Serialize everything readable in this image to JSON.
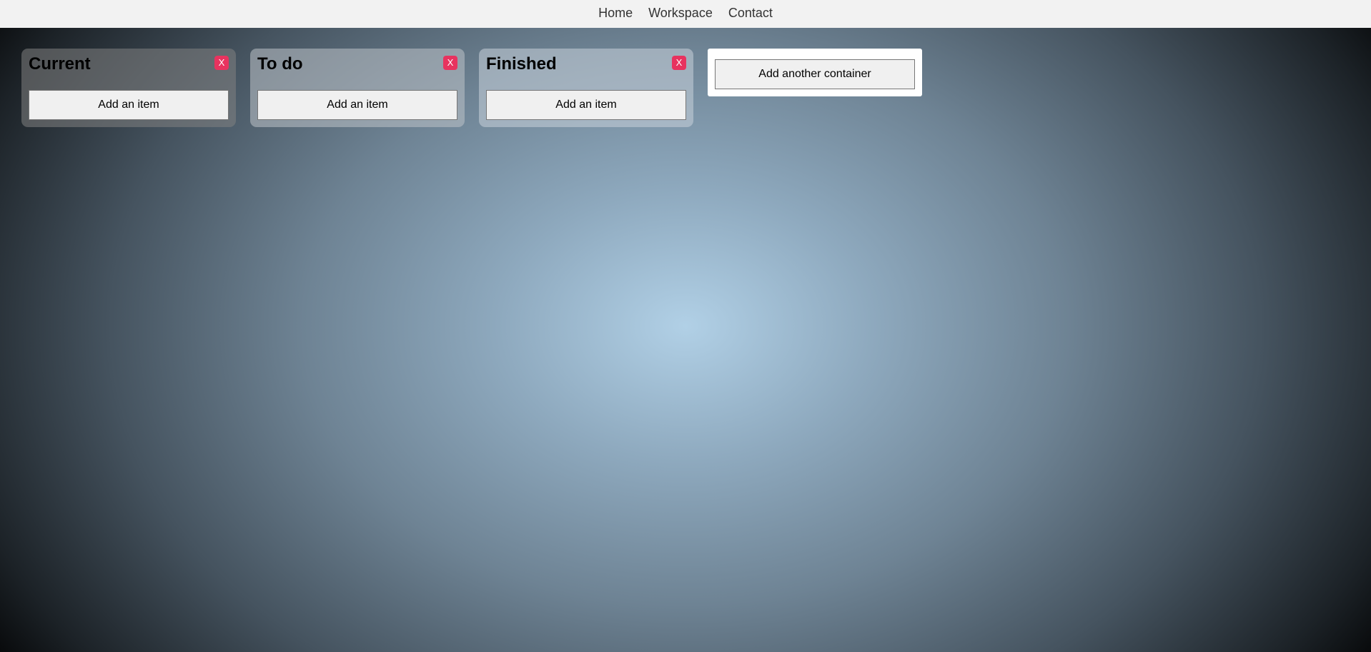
{
  "nav": {
    "links": [
      "Home",
      "Workspace",
      "Contact"
    ]
  },
  "board": {
    "containers": [
      {
        "title": "Current",
        "close_label": "X",
        "add_item_label": "Add an item",
        "background": "rgba(130,130,130,0.55)"
      },
      {
        "title": "To do",
        "close_label": "X",
        "add_item_label": "Add an item",
        "background": "rgba(190,195,200,0.55)"
      },
      {
        "title": "Finished",
        "close_label": "X",
        "add_item_label": "Add an item",
        "background": "rgba(200,210,218,0.55)"
      }
    ],
    "add_container_label": "Add another container"
  },
  "colors": {
    "navbar_bg": "#f2f2f2",
    "close_button": "#e8335f",
    "background_center": "#b1d0e6",
    "background_edge": "#000000"
  }
}
